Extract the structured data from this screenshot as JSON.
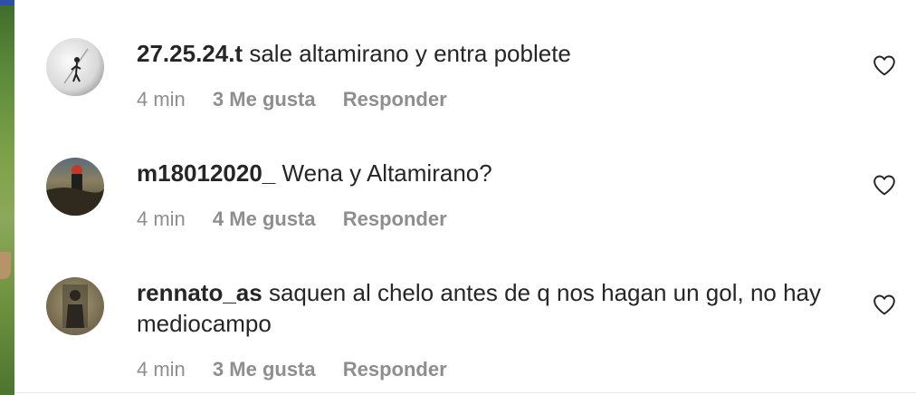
{
  "comments": [
    {
      "username": "27.25.24.t",
      "text": "sale altamirano y entra poblete",
      "time": "4 min",
      "likes": "3 Me gusta",
      "reply": "Responder"
    },
    {
      "username": "m18012020_",
      "text": "Wena y Altamirano?",
      "time": "4 min",
      "likes": "4 Me gusta",
      "reply": "Responder"
    },
    {
      "username": "rennato_as",
      "text": "saquen al chelo antes de q nos hagan un gol, no hay mediocampo",
      "time": "4 min",
      "likes": "3 Me gusta",
      "reply": "Responder"
    }
  ],
  "icons": {
    "like": "heart-icon",
    "avatar": "avatar"
  },
  "colors": {
    "text": "#262626",
    "meta": "#8e8e8e",
    "divider": "#e6e6e6"
  }
}
